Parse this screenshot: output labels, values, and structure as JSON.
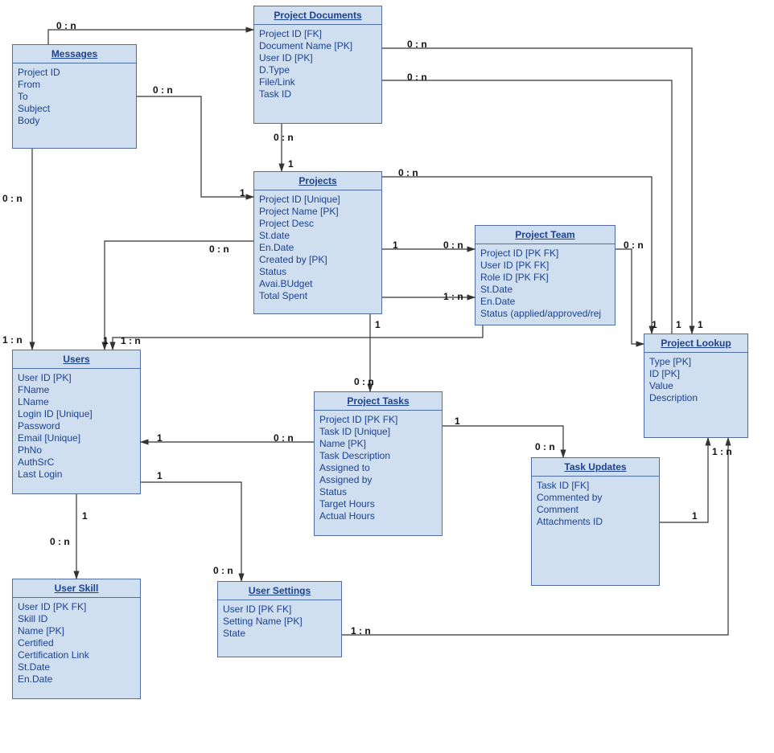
{
  "entities": {
    "messages": {
      "title": "Messages",
      "attrs": [
        "Project ID",
        "From",
        "To",
        "Subject",
        "Body"
      ]
    },
    "projectDocuments": {
      "title": "Project Documents",
      "attrs": [
        "Project ID [FK]",
        "Document Name [PK]",
        "User ID [PK]",
        "D.Type",
        "File/Link",
        "Task ID"
      ]
    },
    "projects": {
      "title": "Projects",
      "attrs": [
        "Project ID [Unique]",
        "Project Name [PK]",
        "Project Desc",
        "St.date",
        "En.Date",
        "Created by [PK]",
        "Status",
        "Avai.BUdget",
        "Total Spent"
      ]
    },
    "projectTeam": {
      "title": "Project Team",
      "attrs": [
        "Project ID [PK FK]",
        "User ID [PK FK]",
        "Role ID [PK FK]",
        "St.Date",
        "En.Date",
        "Status (applied/approved/rej"
      ]
    },
    "users": {
      "title": "Users",
      "attrs": [
        "User ID [PK]",
        "FName",
        "LName",
        "Login ID [Unique]",
        "Password",
        "Email  [Unique]",
        "PhNo",
        "AuthSrC",
        "Last Login"
      ]
    },
    "projectLookup": {
      "title": "Project Lookup",
      "attrs": [
        "Type [PK]",
        "ID [PK]",
        "Value",
        "Description"
      ]
    },
    "projectTasks": {
      "title": "Project Tasks",
      "attrs": [
        "Project ID [PK FK]",
        "Task ID [Unique]",
        "Name [PK]",
        "Task Description",
        "Assigned to",
        "Assigned by",
        "Status",
        "Target Hours",
        "Actual Hours"
      ]
    },
    "taskUpdates": {
      "title": "Task Updates",
      "attrs": [
        "Task ID [FK]",
        "Commented by",
        "Comment",
        "Attachments ID"
      ]
    },
    "userSkill": {
      "title": "User Skill",
      "attrs": [
        "User ID [PK FK]",
        "Skill ID",
        "Name [PK]",
        "Certified",
        "Certification Link",
        "St.Date",
        "En.Date"
      ]
    },
    "userSettings": {
      "title": "User Settings",
      "attrs": [
        "User ID [PK FK]",
        "Setting Name [PK]",
        "State"
      ]
    }
  },
  "labels": {
    "l_msg_docs_start": "0 : n",
    "l_msg_proj_start": "0 : n",
    "l_msg_proj_end": "1",
    "l_msg_users_start": "0 : n",
    "l_msg_users_end": "1 : n",
    "l_docs_proj_start": "0 : n",
    "l_docs_proj_end": "1",
    "l_docs_lookup_start": "0 : n",
    "l_docs_team_start": "0 : n",
    "l_docs_lookup_end": "1",
    "l_docs_team_end": "1",
    "l_users_proj_start": "0 : n",
    "l_users_proj_end": "1",
    "l_users_team_start": "1 : n",
    "l_team_users_end": "1",
    "l_proj_team_start": "1",
    "l_proj_team_end": "0 : n",
    "l_team_lookup_start": "0 : n",
    "l_proj_lookup_start": "0 : n",
    "l_proj_tasks_start": "1",
    "l_proj_tasks_end": "0 : n",
    "l_tasks_users_start": "0 : n",
    "l_tasks_users_end": "1",
    "l_tasks_updates_start": "1",
    "l_tasks_updates_end": "0 : n",
    "l_updates_lookup_start": "1 : n",
    "l_updates_lookup_end": "1",
    "l_users_skill_start": "1",
    "l_users_skill_end": "0 : n",
    "l_users_settings_start": "1",
    "l_users_settings_end": "0 : n",
    "l_settings_lookup_start": "1 : n"
  }
}
